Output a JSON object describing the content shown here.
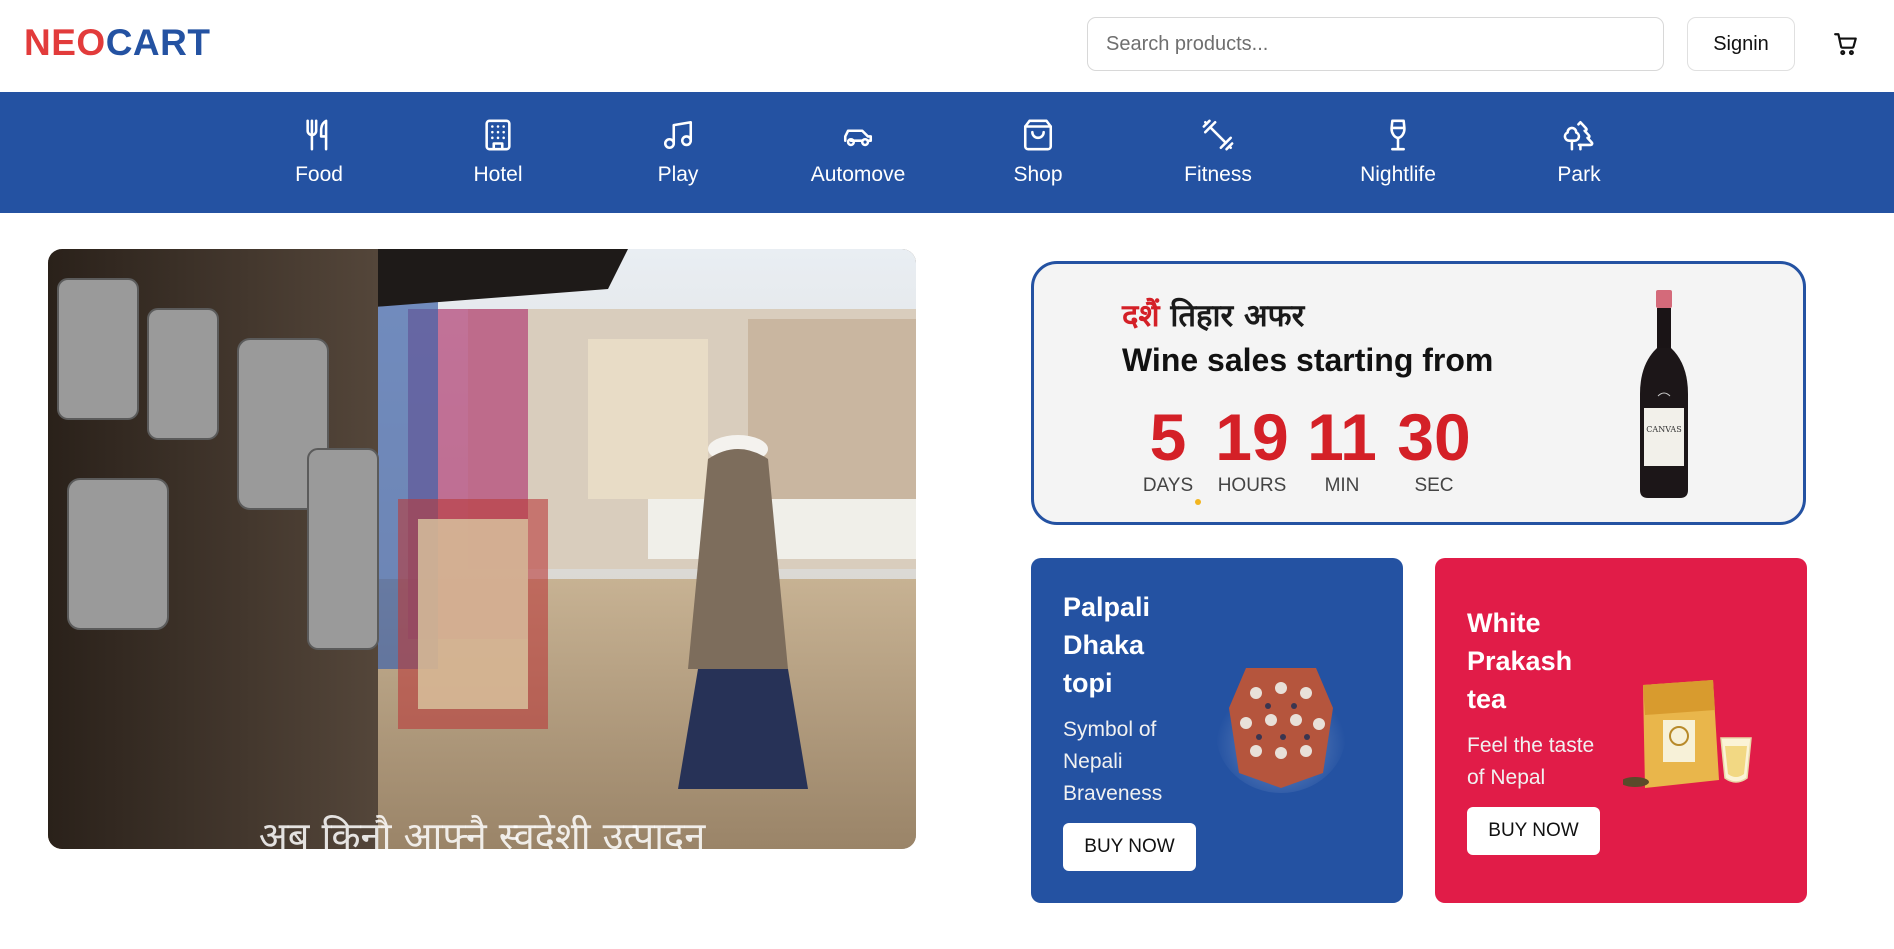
{
  "header": {
    "logo_part1": "NEO",
    "logo_part2": "CART",
    "search_placeholder": "Search products...",
    "signin_label": "Signin",
    "cart_icon": "cart-icon"
  },
  "nav": {
    "items": [
      {
        "label": "Food",
        "icon": "fork-knife-icon"
      },
      {
        "label": "Hotel",
        "icon": "hotel-icon"
      },
      {
        "label": "Play",
        "icon": "music-note-icon"
      },
      {
        "label": "Automove",
        "icon": "car-icon"
      },
      {
        "label": "Shop",
        "icon": "shopping-bag-icon"
      },
      {
        "label": "Fitness",
        "icon": "dumbbell-icon"
      },
      {
        "label": "Nightlife",
        "icon": "wine-glass-icon"
      },
      {
        "label": "Park",
        "icon": "trees-icon"
      }
    ]
  },
  "hero": {
    "caption": "अब किनौ आफ्नै स्वदेशी उत्पादन"
  },
  "promo": {
    "head_red": "दशैं",
    "head_rest": " तिहार अफर",
    "subtitle": "Wine sales starting from",
    "countdown": [
      {
        "value": "5",
        "unit": "DAYS"
      },
      {
        "value": "19",
        "unit": "HOURS"
      },
      {
        "value": "11",
        "unit": "MIN"
      },
      {
        "value": "30",
        "unit": "SEC"
      }
    ],
    "bottle_label": "CANVAS"
  },
  "cards": [
    {
      "title_lines": [
        "Palpali",
        "Dhaka",
        "topi"
      ],
      "desc_lines": [
        "Symbol of",
        "Nepali",
        "Braveness"
      ],
      "button": "BUY NOW"
    },
    {
      "title_lines": [
        "White",
        "Prakash",
        "tea"
      ],
      "desc_lines": [
        "Feel the taste",
        "of Nepal"
      ],
      "button": "BUY NOW"
    }
  ],
  "colors": {
    "brand_blue": "#2452a2",
    "brand_red": "#e23b3b",
    "accent_pink": "#e11c48",
    "countdown_red": "#d42027"
  }
}
